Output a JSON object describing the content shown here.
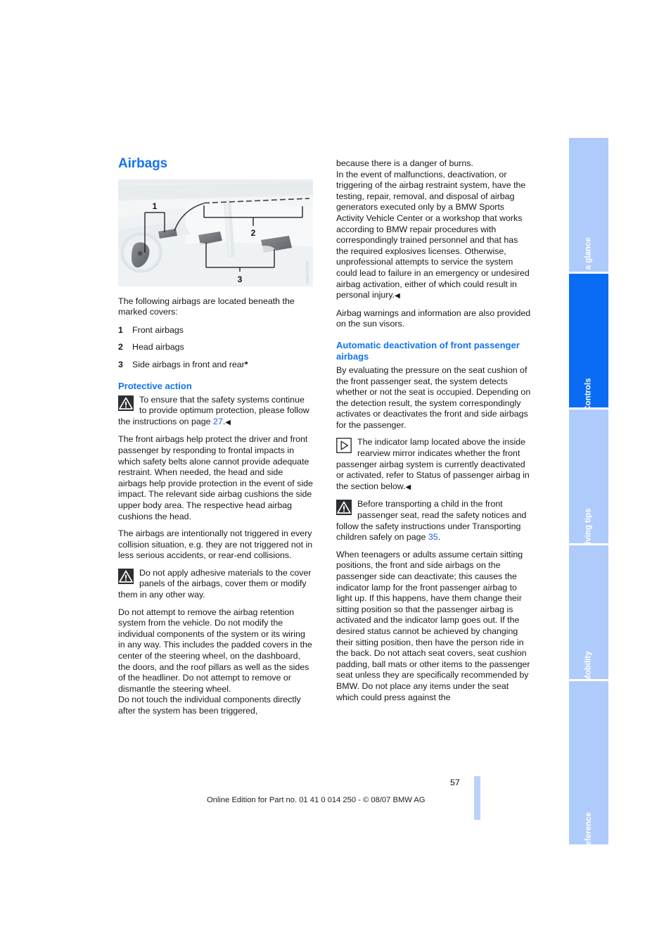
{
  "document": {
    "page_number": "57",
    "imprint": "Online Edition for Part no. 01 41 0 014 250 - © 08/07 BMW AG",
    "illustration_watermark": "WCD14AMA"
  },
  "tabs": [
    {
      "label": "At a glance",
      "active": false
    },
    {
      "label": "Controls",
      "active": true
    },
    {
      "label": "Driving tips",
      "active": false
    },
    {
      "label": "Mobility",
      "active": false
    },
    {
      "label": "Reference",
      "active": false
    }
  ],
  "left_column": {
    "title": "Airbags",
    "illustration_labels": {
      "one": "1",
      "two": "2",
      "three": "3"
    },
    "intro": "The following airbags are located beneath the marked covers:",
    "legend": [
      {
        "num": "1",
        "text": "Front airbags"
      },
      {
        "num": "2",
        "text": "Head airbags"
      },
      {
        "num": "3",
        "text": "Side airbags in front and rear",
        "footnote": "*"
      }
    ],
    "subheading": "Protective action",
    "warning_1": {
      "icon": "warning-triangle-icon",
      "text_before_ref": "To ensure that the safety systems continue to provide optimum protection, please follow the instructions on page ",
      "page_ref": "27",
      "text_after_ref": ".",
      "endmark": "◀"
    },
    "paragraph_1": "The front airbags help protect the driver and front passenger by responding to frontal impacts in which safety belts alone cannot provide adequate restraint. When needed, the head and side airbags help provide protection in the event of side impact. The relevant side airbag cushions the side upper body area. The respective head airbag cushions the head.",
    "paragraph_2": "The airbags are intentionally not triggered in every collision situation, e.g. they are not triggered not in less serious accidents, or rear-end collisions.",
    "warning_2": {
      "icon": "warning-triangle-icon",
      "text": "Do not apply adhesive materials to the cover panels of the airbags, cover them or modify them in any other way."
    },
    "paragraph_3": "Do not attempt to remove the airbag retention system from the vehicle. Do not modify the individual components of the system or its wiring in any way. This includes the padded covers in the center of the steering wheel, on the dashboard, the doors, and the roof pillars as well as the sides of the headliner. Do not attempt to remove or dismantle the steering wheel.",
    "paragraph_4": "Do not touch the individual components directly after the system has been triggered,"
  },
  "right_column": {
    "paragraph_1": "because there is a danger of burns.",
    "paragraph_2_before_endmark": "In the event of malfunctions, deactivation, or triggering of the airbag restraint system, have the testing, repair, removal, and disposal of airbag generators executed only by a BMW Sports Activity Vehicle Center or a workshop that works according to BMW repair procedures with correspondingly trained personnel and that has the required explosives licenses. Otherwise, unprofessional attempts to service the system could lead to failure in an emergency or undesired airbag activation, either of which could result in personal injury.",
    "endmark_1": "◀",
    "paragraph_3": "Airbag warnings and information are also provided on the sun visors.",
    "subheading": "Automatic deactivation of front passenger airbags",
    "paragraph_4": "By evaluating the pressure on the seat cushion of the front passenger seat, the system detects whether or not the seat is occupied. Depending on the detection result, the system correspondingly activates or deactivates the front and side airbags for the passenger.",
    "note_1": {
      "icon": "info-triangle-box-icon",
      "text": "The indicator lamp located above the inside rearview mirror indicates whether the front passenger airbag system is currently deactivated or activated, refer to Status of passenger airbag in the section below.",
      "endmark": "◀"
    },
    "warning_1": {
      "icon": "warning-triangle-icon",
      "text_before_ref": "Before transporting a child in the front passenger seat, read the safety notices and follow the safety instructions under Transporting children safely on page ",
      "page_ref": "35",
      "text_after_ref": "."
    },
    "paragraph_5": "When teenagers or adults assume certain sitting positions, the front and side airbags on the passenger side can deactivate; this causes the indicator lamp for the front passenger airbag to light up. If this happens, have them change their sitting position so that the passenger airbag is activated and the indicator lamp goes out. If the desired status cannot be achieved by changing their sitting position, then have the person ride in the back. Do not attach seat covers, seat cushion padding, ball mats or other items to the passenger seat unless they are specifically recommended by BMW. Do not place any items under the seat which could press against the"
  },
  "colors": {
    "heading_blue": "#1274f0",
    "tab_active": "#0a6cf5",
    "tab_inactive": "#aecbfb",
    "page_bar": "#b9d2fa",
    "link_blue": "#1a5fe0"
  }
}
